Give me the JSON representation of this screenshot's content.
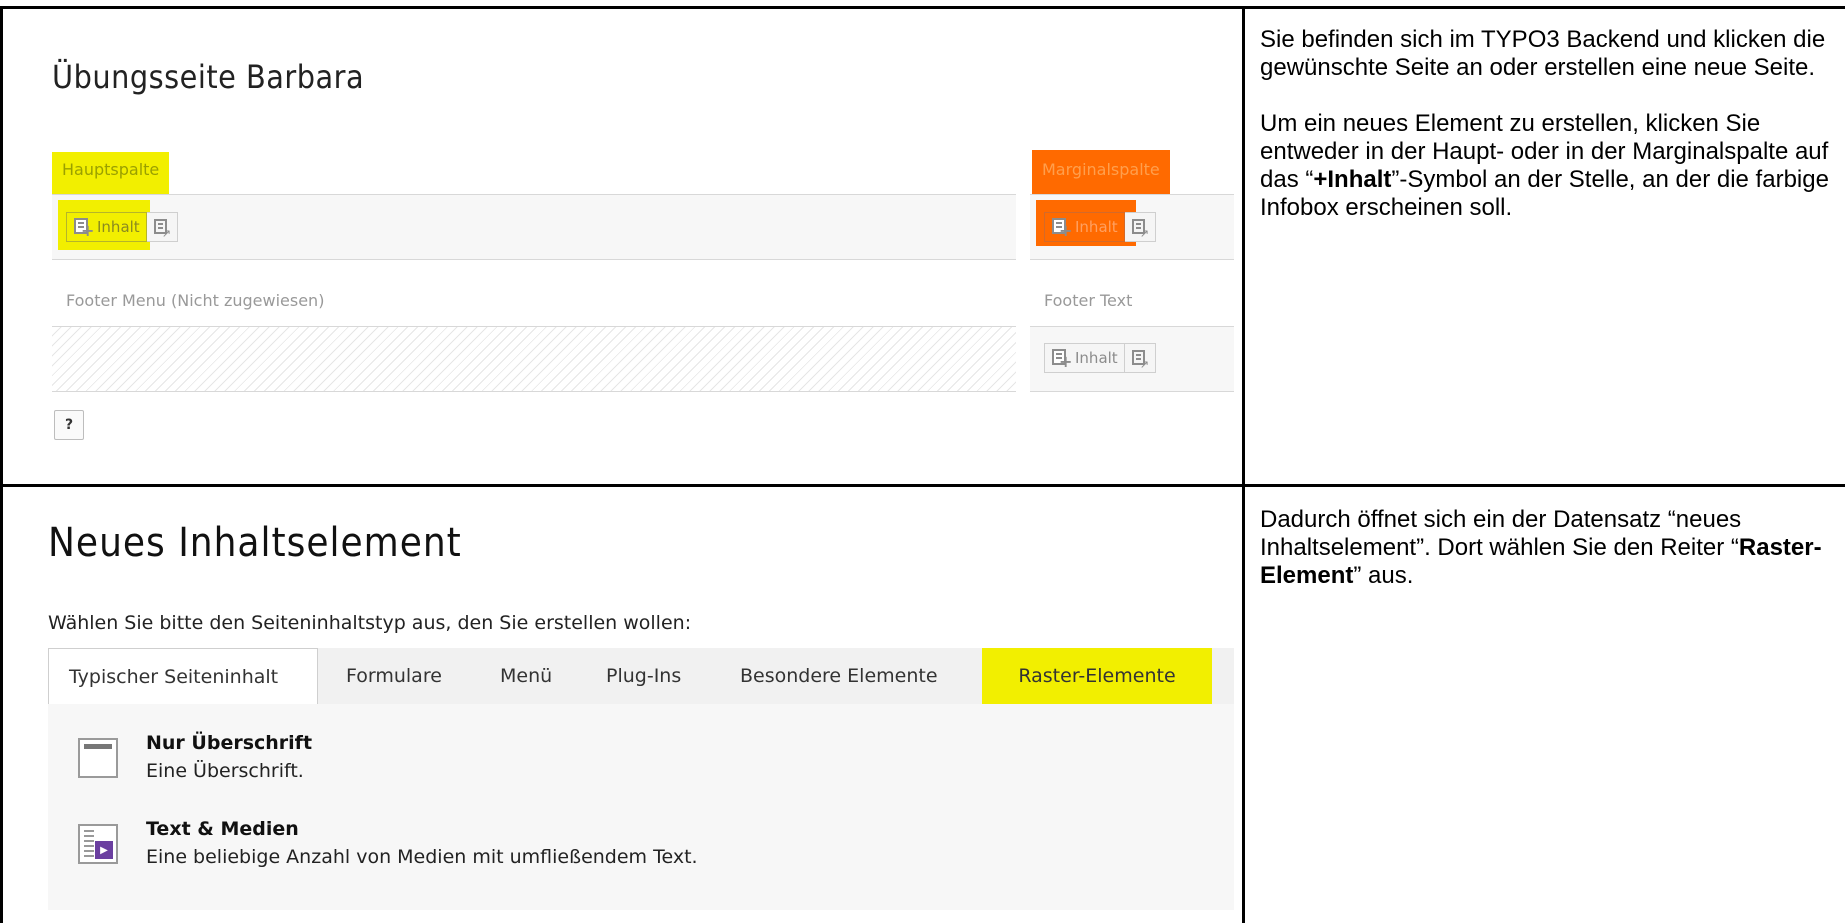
{
  "top": {
    "page_title": "Übungsseite Barbara",
    "main_column_label": "Hauptspalte",
    "side_column_label": "Marginalspalte",
    "content_button_label": "Inhalt",
    "footer_menu_label": "Footer Menu (Nicht zugewiesen)",
    "footer_text_label": "Footer Text",
    "help_button_label": "?",
    "description_p1": "Sie befinden sich im TYPO3 Backend und klicken die gewünschte Seite an oder erstellen eine neue Seite.",
    "description_p2_pre": "Um ein neues Element zu erstellen, klicken Sie entweder in der Haupt- oder in der Marginalspalte auf das “",
    "description_p2_bold": "+Inhalt",
    "description_p2_post": "”-Symbol an der Stelle, an der die farbige Infobox erscheinen soll."
  },
  "bottom": {
    "title": "Neues Inhaltselement",
    "instruction": "Wählen Sie bitte den Seiteninhaltstyp aus, den Sie erstellen wollen:",
    "tabs": [
      {
        "label": "Typischer Seiteninhalt"
      },
      {
        "label": "Formulare"
      },
      {
        "label": "Menü"
      },
      {
        "label": "Plug-Ins"
      },
      {
        "label": "Besondere Elemente"
      },
      {
        "label": "Raster-Elemente"
      }
    ],
    "items": [
      {
        "title": "Nur Überschrift",
        "description": "Eine Überschrift.",
        "icon": "header-icon"
      },
      {
        "title": "Text & Medien",
        "description": "Eine beliebige Anzahl von Medien mit umfließendem Text.",
        "icon": "text-media-icon"
      }
    ],
    "description_pre": "Dadurch öffnet sich ein der Datensatz “neues Inhaltselement”. Dort wählen Sie den Reiter “",
    "description_bold": "Raster-Element",
    "description_post": "” aus."
  },
  "colors": {
    "highlight_yellow": "#f2ef00",
    "highlight_orange": "#ff6a00",
    "text_media_accent": "#6b3fa0"
  }
}
